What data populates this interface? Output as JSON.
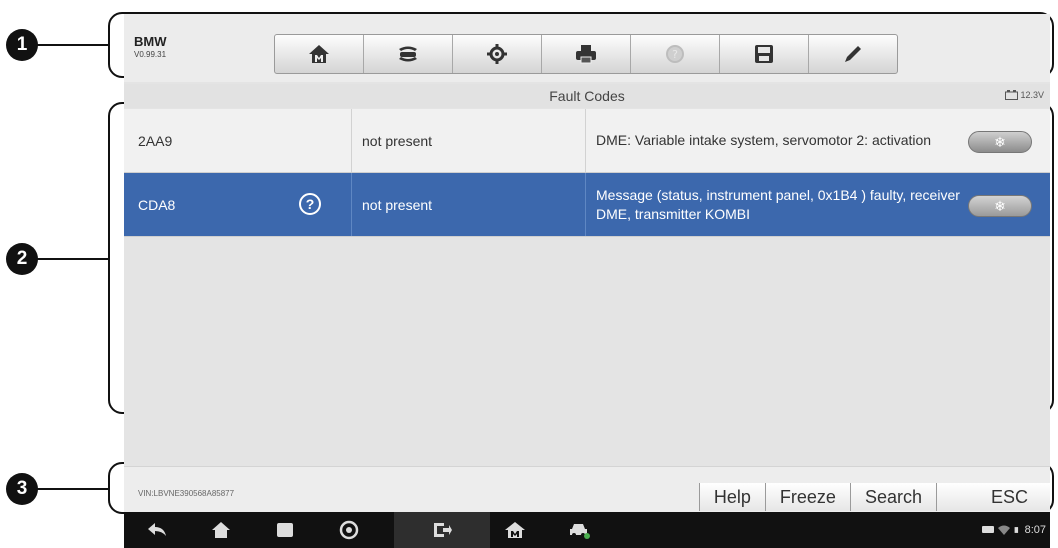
{
  "vehicle": {
    "make": "BMW",
    "version": "V0.99.31"
  },
  "toolbar": {
    "buttons": [
      {
        "name": "home-icon"
      },
      {
        "name": "vehicle-swap-icon"
      },
      {
        "name": "settings-gear-icon"
      },
      {
        "name": "printer-icon"
      },
      {
        "name": "help-icon"
      },
      {
        "name": "save-icon"
      },
      {
        "name": "edit-pen-icon"
      }
    ]
  },
  "title_bar": {
    "title": "Fault Codes",
    "battery_voltage": "12.3V"
  },
  "fault_codes": [
    {
      "code": "2AA9",
      "status": "not present",
      "description": "DME: Variable intake system, servomotor 2: activation",
      "selected": false,
      "has_help": false
    },
    {
      "code": "CDA8",
      "status": "not present",
      "description": "Message (status, instrument panel, 0x1B4 ) faulty, receiver DME, transmitter KOMBI",
      "selected": true,
      "has_help": true
    }
  ],
  "row_button_glyph": "❄",
  "help_glyph": "?",
  "function_bar": {
    "vin": "VIN:LBVNE390568A85877",
    "buttons": {
      "help": "Help",
      "freeze": "Freeze",
      "search": "Search",
      "esc": "ESC"
    }
  },
  "system_bar": {
    "time": "8:07"
  },
  "callouts": {
    "c1": "1",
    "c2": "2",
    "c3": "3"
  },
  "colors": {
    "selected_row": "#3c68ad",
    "row_bg": "#f1f1f1",
    "nav_bar": "#111111"
  }
}
